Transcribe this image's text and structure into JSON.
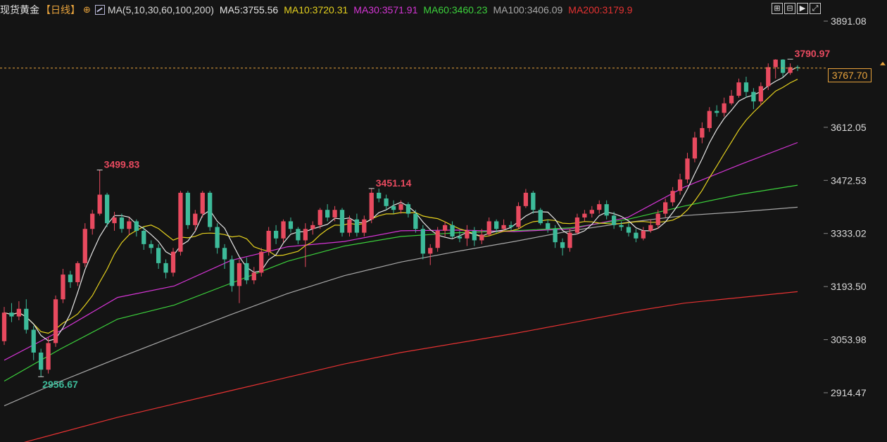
{
  "legend": {
    "symbol": "现货黄金",
    "period": "【日线】",
    "add_icon": "circle-plus-icon",
    "ma_icon": "indicator-chart-icon",
    "ma_config": "MA(5,10,30,60,100,200)",
    "ma_values": [
      {
        "text": "MA5:3755.56",
        "color": "#e6e6e6"
      },
      {
        "text": "MA10:3720.31",
        "color": "#e6d21e"
      },
      {
        "text": "MA30:3571.91",
        "color": "#d535d5"
      },
      {
        "text": "MA60:3460.23",
        "color": "#3cd23c"
      },
      {
        "text": "MA100:3406.09",
        "color": "#a8a8a8"
      },
      {
        "text": "MA200:3179.9",
        "color": "#e63232"
      }
    ]
  },
  "tools": [
    {
      "icon": "crosshair-icon",
      "glyph": "⊞"
    },
    {
      "icon": "split-pane-icon",
      "glyph": "⊟"
    },
    {
      "icon": "play-icon",
      "glyph": "▶"
    },
    {
      "icon": "expand-icon",
      "glyph": "⤢"
    }
  ],
  "current_price": "3767.70",
  "chart_data": {
    "type": "candlestick",
    "y_ticks": [
      "3891.08",
      "3612.05",
      "3472.53",
      "3333.02",
      "3193.50",
      "3053.98",
      "2914.47"
    ],
    "y_tick_values": [
      3891.08,
      3612.05,
      3472.53,
      3333.02,
      3193.5,
      3053.98,
      2914.47
    ],
    "annotations": [
      {
        "text": "3790.97",
        "value": 3790.97,
        "kind": "high"
      },
      {
        "text": "3499.83",
        "value": 3499.83,
        "kind": "high"
      },
      {
        "text": "3451.14",
        "value": 3451.14,
        "kind": "high"
      },
      {
        "text": "2956.67",
        "value": 2956.67,
        "kind": "low"
      }
    ],
    "current_price": 3767.7,
    "up_color": "#e84a5f",
    "down_color": "#3dbb9a",
    "ma_series": [
      {
        "name": "MA100",
        "color": "#a8a8a8",
        "values": [
          2880,
          2945,
          3005,
          3063,
          3120,
          3175,
          3222,
          3258,
          3286,
          3312,
          3340,
          3362,
          3380,
          3390,
          3402
        ]
      },
      {
        "name": "MA200",
        "color": "#e63232",
        "values": [
          2770,
          2810,
          2850,
          2885,
          2920,
          2955,
          2990,
          3020,
          3045,
          3070,
          3098,
          3126,
          3150,
          3165,
          3180
        ]
      },
      {
        "name": "MA60",
        "color": "#3cd23c",
        "values": [
          2945,
          3030,
          3108,
          3145,
          3202,
          3260,
          3300,
          3325,
          3335,
          3340,
          3348,
          3370,
          3405,
          3436,
          3460
        ]
      },
      {
        "name": "MA30",
        "color": "#d535d5",
        "values": [
          3000,
          3078,
          3165,
          3195,
          3262,
          3298,
          3312,
          3340,
          3342,
          3338,
          3345,
          3375,
          3455,
          3515,
          3572
        ]
      }
    ],
    "candles": [
      [
        3050,
        3125,
        3140,
        3040
      ],
      [
        3125,
        3115,
        3150,
        3100
      ],
      [
        3115,
        3135,
        3155,
        3105
      ],
      [
        3135,
        3080,
        3160,
        3070
      ],
      [
        3080,
        3020,
        3090,
        3000
      ],
      [
        3020,
        2975,
        3030,
        2957
      ],
      [
        2975,
        3045,
        3060,
        2965
      ],
      [
        3045,
        3160,
        3170,
        3035
      ],
      [
        3160,
        3225,
        3240,
        3150
      ],
      [
        3225,
        3205,
        3235,
        3190
      ],
      [
        3205,
        3255,
        3260,
        3195
      ],
      [
        3255,
        3345,
        3360,
        3245
      ],
      [
        3345,
        3385,
        3395,
        3330
      ],
      [
        3385,
        3435,
        3500,
        3380
      ],
      [
        3435,
        3360,
        3440,
        3350
      ],
      [
        3360,
        3375,
        3390,
        3340
      ],
      [
        3375,
        3345,
        3385,
        3335
      ],
      [
        3345,
        3365,
        3375,
        3330
      ],
      [
        3365,
        3340,
        3370,
        3325
      ],
      [
        3340,
        3305,
        3350,
        3290
      ],
      [
        3305,
        3295,
        3315,
        3280
      ],
      [
        3295,
        3255,
        3305,
        3240
      ],
      [
        3255,
        3230,
        3265,
        3215
      ],
      [
        3230,
        3285,
        3295,
        3220
      ],
      [
        3285,
        3440,
        3445,
        3275
      ],
      [
        3440,
        3355,
        3445,
        3345
      ],
      [
        3355,
        3385,
        3395,
        3340
      ],
      [
        3385,
        3440,
        3445,
        3375
      ],
      [
        3440,
        3350,
        3445,
        3340
      ],
      [
        3350,
        3295,
        3360,
        3280
      ],
      [
        3295,
        3265,
        3305,
        3240
      ],
      [
        3265,
        3195,
        3275,
        3180
      ],
      [
        3195,
        3255,
        3265,
        3150
      ],
      [
        3255,
        3210,
        3270,
        3200
      ],
      [
        3210,
        3230,
        3245,
        3200
      ],
      [
        3230,
        3285,
        3295,
        3220
      ],
      [
        3285,
        3340,
        3350,
        3275
      ],
      [
        3340,
        3320,
        3355,
        3305
      ],
      [
        3320,
        3365,
        3370,
        3310
      ],
      [
        3365,
        3345,
        3375,
        3335
      ],
      [
        3345,
        3315,
        3350,
        3305
      ],
      [
        3315,
        3345,
        3360,
        3245
      ],
      [
        3345,
        3355,
        3365,
        3330
      ],
      [
        3355,
        3395,
        3400,
        3345
      ],
      [
        3395,
        3375,
        3410,
        3365
      ],
      [
        3375,
        3395,
        3405,
        3365
      ],
      [
        3395,
        3335,
        3400,
        3325
      ],
      [
        3335,
        3370,
        3380,
        3325
      ],
      [
        3370,
        3335,
        3385,
        3325
      ],
      [
        3335,
        3370,
        3380,
        3325
      ],
      [
        3370,
        3440,
        3451,
        3360
      ],
      [
        3440,
        3425,
        3451,
        3415
      ],
      [
        3425,
        3405,
        3435,
        3395
      ],
      [
        3405,
        3395,
        3420,
        3385
      ],
      [
        3395,
        3410,
        3420,
        3385
      ],
      [
        3410,
        3385,
        3415,
        3375
      ],
      [
        3385,
        3345,
        3395,
        3335
      ],
      [
        3345,
        3280,
        3355,
        3265
      ],
      [
        3280,
        3295,
        3305,
        3250
      ],
      [
        3295,
        3340,
        3350,
        3285
      ],
      [
        3340,
        3355,
        3365,
        3325
      ],
      [
        3355,
        3325,
        3365,
        3320
      ],
      [
        3325,
        3320,
        3340,
        3310
      ],
      [
        3320,
        3340,
        3355,
        3300
      ],
      [
        3340,
        3315,
        3350,
        3300
      ],
      [
        3315,
        3330,
        3345,
        3305
      ],
      [
        3330,
        3365,
        3375,
        3325
      ],
      [
        3365,
        3345,
        3370,
        3335
      ],
      [
        3345,
        3355,
        3370,
        3340
      ],
      [
        3355,
        3350,
        3365,
        3340
      ],
      [
        3350,
        3405,
        3415,
        3345
      ],
      [
        3405,
        3440,
        3450,
        3400
      ],
      [
        3440,
        3395,
        3445,
        3385
      ],
      [
        3395,
        3360,
        3400,
        3355
      ],
      [
        3360,
        3345,
        3370,
        3335
      ],
      [
        3345,
        3310,
        3355,
        3295
      ],
      [
        3310,
        3295,
        3320,
        3275
      ],
      [
        3295,
        3335,
        3345,
        3285
      ],
      [
        3335,
        3375,
        3385,
        3330
      ],
      [
        3375,
        3385,
        3395,
        3365
      ],
      [
        3385,
        3395,
        3405,
        3375
      ],
      [
        3395,
        3410,
        3420,
        3385
      ],
      [
        3410,
        3380,
        3420,
        3370
      ],
      [
        3380,
        3355,
        3390,
        3345
      ],
      [
        3355,
        3350,
        3365,
        3340
      ],
      [
        3350,
        3335,
        3360,
        3325
      ],
      [
        3335,
        3320,
        3345,
        3310
      ],
      [
        3320,
        3340,
        3350,
        3315
      ],
      [
        3340,
        3355,
        3370,
        3335
      ],
      [
        3355,
        3385,
        3395,
        3345
      ],
      [
        3385,
        3415,
        3425,
        3375
      ],
      [
        3415,
        3445,
        3455,
        3405
      ],
      [
        3445,
        3475,
        3490,
        3435
      ],
      [
        3475,
        3530,
        3545,
        3465
      ],
      [
        3530,
        3585,
        3600,
        3520
      ],
      [
        3585,
        3610,
        3625,
        3570
      ],
      [
        3610,
        3655,
        3665,
        3600
      ],
      [
        3655,
        3650,
        3670,
        3640
      ],
      [
        3650,
        3675,
        3690,
        3640
      ],
      [
        3675,
        3695,
        3710,
        3670
      ],
      [
        3695,
        3730,
        3740,
        3690
      ],
      [
        3730,
        3705,
        3745,
        3690
      ],
      [
        3705,
        3680,
        3715,
        3660
      ],
      [
        3680,
        3720,
        3730,
        3670
      ],
      [
        3720,
        3770,
        3780,
        3710
      ],
      [
        3770,
        3790,
        3791,
        3740
      ],
      [
        3790,
        3755,
        3791,
        3745
      ],
      [
        3755,
        3770,
        3780,
        3750
      ],
      [
        3770,
        3768,
        3775,
        3760
      ]
    ]
  }
}
